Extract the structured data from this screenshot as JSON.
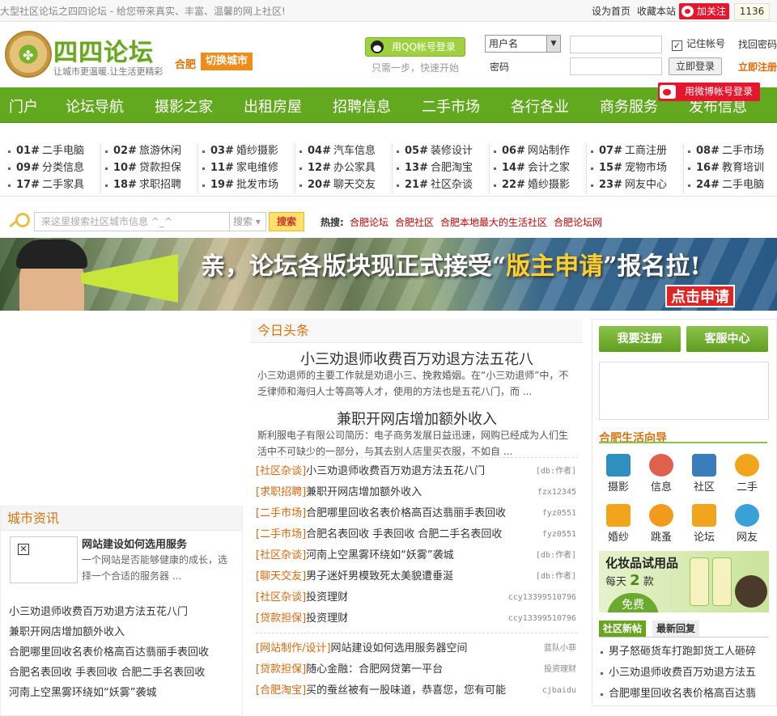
{
  "topbar": {
    "tagline": "大型社区论坛之四四论坛 - 给您带来真实、丰富、温馨的网上社区!",
    "set_home": "设为首页",
    "bookmark": "收藏本站",
    "follow": "加关注",
    "follow_count": "1136"
  },
  "header": {
    "site_title": "四四论坛",
    "slogan": "让城市更温暖.让生活更精彩",
    "city": "合肥",
    "switch_city": "切换城市",
    "qq_login": "用QQ帐号登录",
    "qq_note": "只需一步，快速开始",
    "user_select": "用户名",
    "pwd_label": "密码",
    "remember": "记住帐号",
    "find_pwd": "找回密码",
    "login": "立即登录",
    "register": "立即注册",
    "weibo_login": "用微博帐号登录"
  },
  "nav": [
    "门户",
    "论坛导航",
    "摄影之家",
    "出租房屋",
    "招聘信息",
    "二手市场",
    "各行各业",
    "商务服务",
    "发布信息"
  ],
  "categories": [
    [
      [
        "01#",
        "二手电脑"
      ],
      [
        "09#",
        "分类信息"
      ],
      [
        "17#",
        "二手家具"
      ]
    ],
    [
      [
        "02#",
        "旅游休闲"
      ],
      [
        "10#",
        "贷款担保"
      ],
      [
        "18#",
        "求职招聘"
      ]
    ],
    [
      [
        "03#",
        "婚纱摄影"
      ],
      [
        "11#",
        "家电维修"
      ],
      [
        "19#",
        "批发市场"
      ]
    ],
    [
      [
        "04#",
        "汽车信息"
      ],
      [
        "12#",
        "办公家具"
      ],
      [
        "20#",
        "聊天交友"
      ]
    ],
    [
      [
        "05#",
        "装修设计"
      ],
      [
        "13#",
        "合肥淘宝"
      ],
      [
        "21#",
        "社区杂谈"
      ]
    ],
    [
      [
        "06#",
        "网站制作"
      ],
      [
        "14#",
        "会计之家"
      ],
      [
        "22#",
        "婚纱摄影"
      ]
    ],
    [
      [
        "07#",
        "工商注册"
      ],
      [
        "15#",
        "宠物市场"
      ],
      [
        "23#",
        "网友中心"
      ]
    ],
    [
      [
        "08#",
        "二手市场"
      ],
      [
        "16#",
        "教育培训"
      ],
      [
        "24#",
        "二手电脑"
      ]
    ]
  ],
  "search": {
    "placeholder": "来这里搜索社区城市信息 ^_^",
    "type": "搜索",
    "button": "搜索",
    "hot_label": "热搜:",
    "hot": [
      "合肥论坛",
      "合肥社区",
      "合肥本地最大的生活社区",
      "合肥论坛网"
    ]
  },
  "banner": {
    "text_a": "亲，论坛各版块现正式接受“",
    "text_hl": "版主申请",
    "text_b": "”报名拉!",
    "apply": "点击申请"
  },
  "headline": {
    "title": "今日头条",
    "items": [
      {
        "title": "小三劝退师收费百万劝退方法五花八",
        "desc": "小三劝退师的主要工作就是劝退小三、挽救婚姻。在“小三劝退师”中，不乏律师和海归人士等高等人才，使用的方法也是五花八门，而 ..."
      },
      {
        "title": "兼职开网店增加额外收入",
        "desc": "斯利服电子有限公司简历：电子商务发展日益迅速，网购已经成为人们生活中不可缺少的一部分，与其去别人店里买衣服，不如自 ..."
      }
    ]
  },
  "news": [
    {
      "tag": "[社区杂谈]",
      "title": "小三劝退师收费百万劝退方法五花八门",
      "author": "[db:作者]"
    },
    {
      "tag": "[求职招聘]",
      "title": "兼职开网店增加额外收入",
      "author": "fzx12345"
    },
    {
      "tag": "[二手市场]",
      "title": "合肥哪里回收名表价格高百达翡丽手表回收",
      "author": "fyz0551"
    },
    {
      "tag": "[二手市场]",
      "title": "合肥名表回收 手表回收 合肥二手名表回收",
      "author": "fyz0551"
    },
    {
      "tag": "[社区杂谈]",
      "title": "河南上空黑雾环绕如“妖雾”袭城",
      "author": "[db:作者]"
    },
    {
      "tag": "[聊天交友]",
      "title": "男子迷奸男模致死太美貌遭垂涎",
      "author": "[db:作者]"
    },
    {
      "tag": "[社区杂谈]",
      "title": "投资理财",
      "author": "ccy13399510796"
    },
    {
      "tag": "[贷款担保]",
      "title": "投资理财",
      "author": "ccy13399510796"
    }
  ],
  "news2": [
    {
      "tag": "[网站制作/设计]",
      "title": "网站建设如何选用服务器空间",
      "author": "蓝队小菲"
    },
    {
      "tag": "[贷款担保]",
      "title": "随心金融：合肥网贷第一平台",
      "author": "投资理财"
    },
    {
      "tag": "[合肥淘宝]",
      "title": "买的蚕丝被有一股味道，恭喜您，您有可能",
      "author": "cjbaidu"
    }
  ],
  "city_news": {
    "title": "城市资讯",
    "head": "网站建设如何选用服务",
    "desc": "一个网站是否能够健康的成长，选择一个合适的服务器 ...",
    "list": [
      "小三劝退师收费百万劝退方法五花八门",
      "兼职开网店增加额外收入",
      "合肥哪里回收名表价格高百达翡丽手表回收",
      "合肥名表回收 手表回收 合肥二手名表回收",
      "河南上空黑雾环绕如“妖雾”袭城"
    ]
  },
  "right": {
    "register": "我要注册",
    "service": "客服中心",
    "guide_title": "合肥生活向导",
    "guide": [
      {
        "label": "摄影",
        "icon": "bowl-icon",
        "color": "#2f8fbf"
      },
      {
        "label": "信息",
        "icon": "money-icon",
        "color": "#e0604e"
      },
      {
        "label": "社区",
        "icon": "building-icon",
        "color": "#3a7dbf"
      },
      {
        "label": "二手",
        "icon": "ticket-icon",
        "color": "#f2a51c"
      },
      {
        "label": "婚纱",
        "icon": "bike-icon",
        "color": "#f2a51c"
      },
      {
        "label": "跳蚤",
        "icon": "heart-icon",
        "color": "#f29a1c"
      },
      {
        "label": "论坛",
        "icon": "scissors-icon",
        "color": "#f2a51c"
      },
      {
        "label": "网友",
        "icon": "shower-icon",
        "color": "#3aa0d8"
      }
    ],
    "ad_t1": "化妆品试用品",
    "ad_t2a": "每天",
    "ad_t2b": "2",
    "ad_t2c": "款",
    "ad_free": "免费",
    "tab_on": "社区新帖",
    "tab_off": "最新回复",
    "list": [
      "男子怒砸货车打跑卸货工人砸碎",
      "小三劝退师收费百万劝退方法五",
      "合肥哪里回收名表价格高百达翡"
    ]
  }
}
